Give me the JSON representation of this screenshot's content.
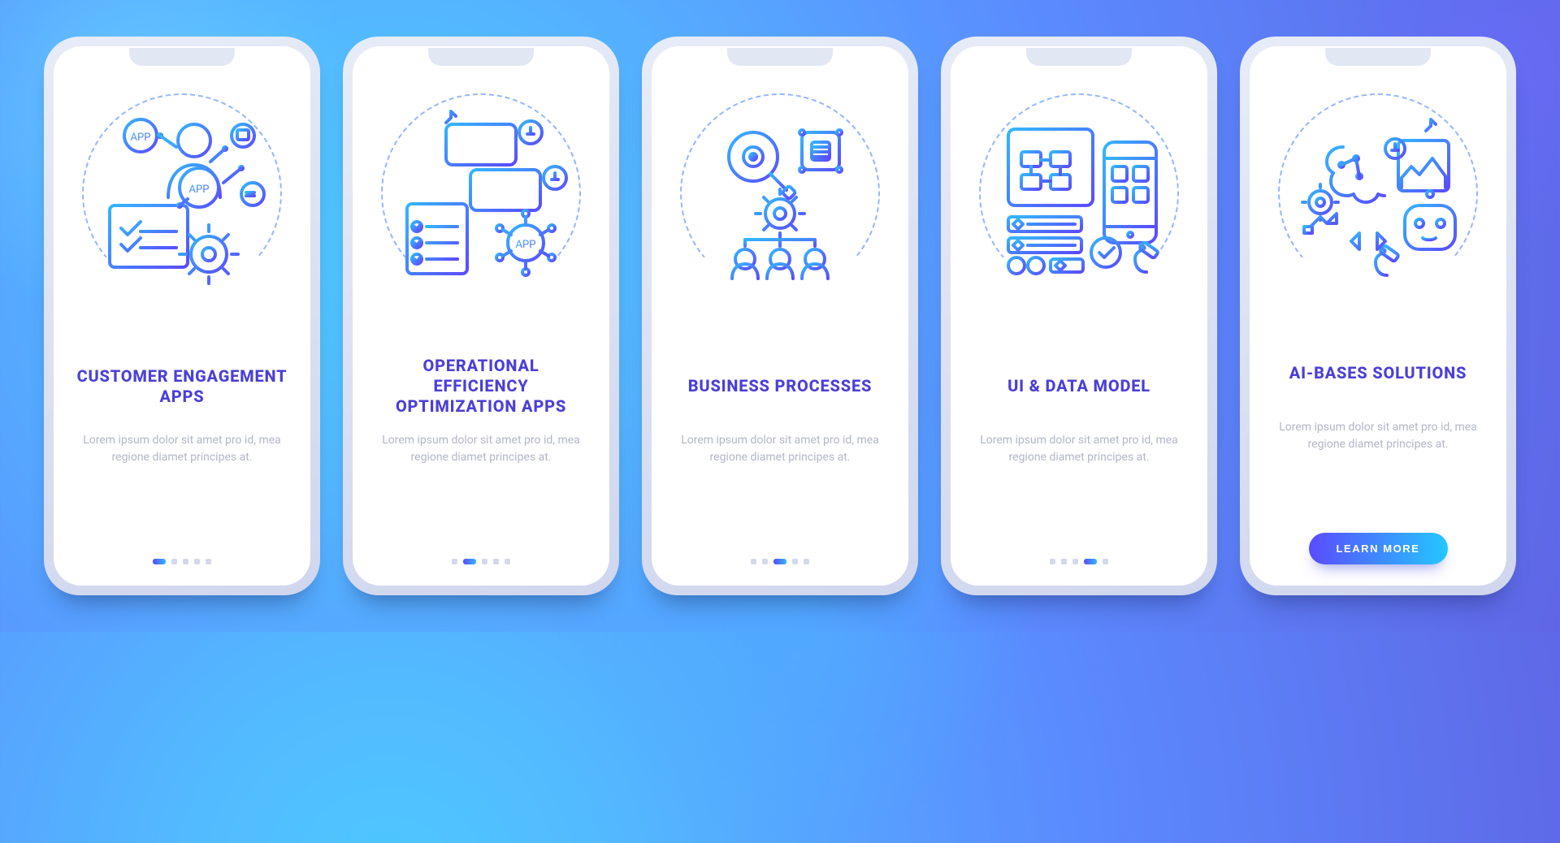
{
  "colors": {
    "brand_dark": "#4b3fd6",
    "grad_from": "#34b6ff",
    "grad_to": "#5a4bff",
    "body_text": "#b3b6c7"
  },
  "lorem": "Lorem ipsum dolor sit amet pro id, mea regione diamet principes at.",
  "cta_label": "LEARN MORE",
  "screens": [
    {
      "icon": "customer-engagement-icon",
      "title": "CUSTOMER ENGAGEMENT APPS",
      "active_dot": 0,
      "has_button": false
    },
    {
      "icon": "operational-efficiency-icon",
      "title": "OPERATIONAL EFFICIENCY OPTIMIZATION APPS",
      "active_dot": 1,
      "has_button": false
    },
    {
      "icon": "business-processes-icon",
      "title": "BUSINESS PROCESSES",
      "active_dot": 2,
      "has_button": false
    },
    {
      "icon": "ui-data-model-icon",
      "title": "UI & DATA MODEL",
      "active_dot": 3,
      "has_button": false
    },
    {
      "icon": "ai-based-solutions-icon",
      "title": "AI-BASES SOLUTIONS",
      "active_dot": 4,
      "has_button": true
    }
  ]
}
